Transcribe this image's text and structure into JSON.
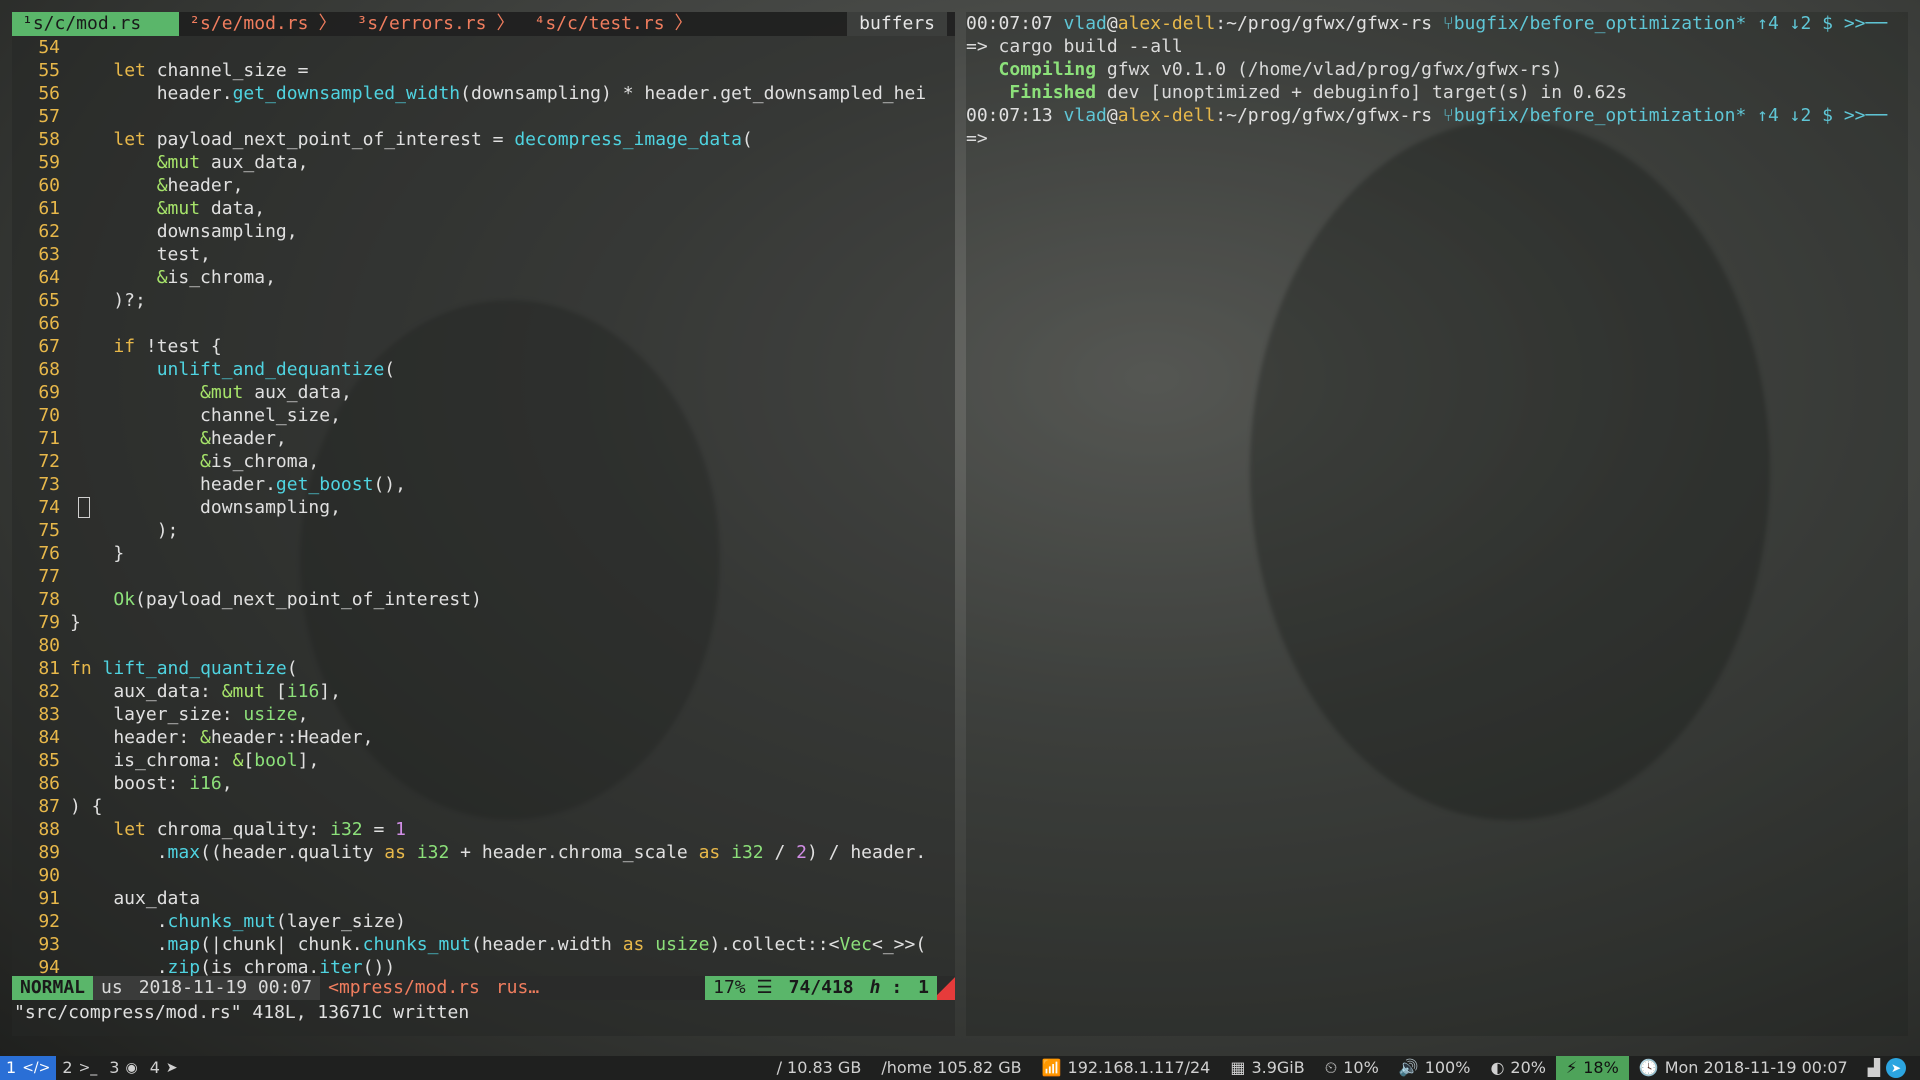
{
  "vim": {
    "tabs": [
      {
        "label": "¹s/c/mod.rs",
        "active": true
      },
      {
        "label": "²s/e/mod.rs",
        "active": false
      },
      {
        "label": "³s/errors.rs",
        "active": false
      },
      {
        "label": "⁴s/c/test.rs",
        "active": false
      }
    ],
    "buffers_label": "buffers",
    "lines": [
      {
        "n": "54",
        "code": ""
      },
      {
        "n": "55",
        "code": "    let channel_size ="
      },
      {
        "n": "56",
        "code": "        header.get_downsampled_width(downsampling) * header.get_downsampled_hei"
      },
      {
        "n": "57",
        "code": ""
      },
      {
        "n": "58",
        "code": "    let payload_next_point_of_interest = decompress_image_data("
      },
      {
        "n": "59",
        "code": "        &mut aux_data,"
      },
      {
        "n": "60",
        "code": "        &header,"
      },
      {
        "n": "61",
        "code": "        &mut data,"
      },
      {
        "n": "62",
        "code": "        downsampling,"
      },
      {
        "n": "63",
        "code": "        test,"
      },
      {
        "n": "64",
        "code": "        &is_chroma,"
      },
      {
        "n": "65",
        "code": "    )?;"
      },
      {
        "n": "66",
        "code": ""
      },
      {
        "n": "67",
        "code": "    if !test {"
      },
      {
        "n": "68",
        "code": "        unlift_and_dequantize("
      },
      {
        "n": "69",
        "code": "            &mut aux_data,"
      },
      {
        "n": "70",
        "code": "            channel_size,"
      },
      {
        "n": "71",
        "code": "            &header,"
      },
      {
        "n": "72",
        "code": "            &is_chroma,"
      },
      {
        "n": "73",
        "code": "            header.get_boost(),"
      },
      {
        "n": "74",
        "code": "            downsampling,"
      },
      {
        "n": "75",
        "code": "        );"
      },
      {
        "n": "76",
        "code": "    }"
      },
      {
        "n": "77",
        "code": ""
      },
      {
        "n": "78",
        "code": "    Ok(payload_next_point_of_interest)"
      },
      {
        "n": "79",
        "code": "}"
      },
      {
        "n": "80",
        "code": ""
      },
      {
        "n": "81",
        "code": "fn lift_and_quantize("
      },
      {
        "n": "82",
        "code": "    aux_data: &mut [i16],"
      },
      {
        "n": "83",
        "code": "    layer_size: usize,"
      },
      {
        "n": "84",
        "code": "    header: &header::Header,"
      },
      {
        "n": "85",
        "code": "    is_chroma: &[bool],"
      },
      {
        "n": "86",
        "code": "    boost: i16,"
      },
      {
        "n": "87",
        "code": ") {"
      },
      {
        "n": "88",
        "code": "    let chroma_quality: i32 = 1"
      },
      {
        "n": "89",
        "code": "        .max((header.quality as i32 + header.chroma_scale as i32 / 2) / header."
      },
      {
        "n": "90",
        "code": ""
      },
      {
        "n": "91",
        "code": "    aux_data"
      },
      {
        "n": "92",
        "code": "        .chunks_mut(layer_size)"
      },
      {
        "n": "93",
        "code": "        .map(|chunk| chunk.chunks_mut(header.width as usize).collect::<Vec<_>>("
      },
      {
        "n": "94",
        "code": "        .zip(is_chroma.iter())"
      }
    ],
    "status": {
      "mode": "NORMAL",
      "keymap": "us",
      "datetime": "2018-11-19 00:07",
      "file": "<mpress/mod.rs",
      "filetype": "rus…",
      "percent": "17% ☰",
      "position": "74/418",
      "column_symbol": "ℎ :",
      "column": "1"
    },
    "cmdline": "\"src/compress/mod.rs\" 418L, 13671C written"
  },
  "terminal": {
    "prompt1": {
      "time": "00:07:07",
      "user": "vlad",
      "host": "alex-dell",
      "path": ":~/prog/gfwx/gfwx-rs",
      "branch": "⑂bugfix/before_optimization* ↑4 ↓2 $ >>──"
    },
    "cmd1": "=> cargo build --all",
    "compile_label": "Compiling",
    "compile_text": " gfwx v0.1.0 (/home/vlad/prog/gfwx/gfwx-rs)",
    "finish_label": "Finished",
    "finish_text": " dev [unoptimized + debuginfo] target(s) in 0.62s",
    "prompt2": {
      "time": "00:07:13",
      "user": "vlad",
      "host": "alex-dell",
      "path": ":~/prog/gfwx/gfwx-rs",
      "branch": "⑂bugfix/before_optimization* ↑4 ↓2 $ >>──"
    },
    "cmd2": "=>"
  },
  "bar": {
    "workspaces": [
      {
        "num": "1",
        "icon": "</>",
        "active": true
      },
      {
        "num": "2",
        "icon": ">_",
        "active": false
      },
      {
        "num": "3",
        "icon": "◉",
        "active": false
      },
      {
        "num": "4",
        "icon": "➤",
        "active": false
      }
    ],
    "disk_root": "/ 10.83 GB",
    "disk_home": "/home 105.82 GB",
    "ip": "192.168.1.117/24",
    "memory": "3.9GiB",
    "cpu": "10%",
    "volume": "100%",
    "brightness": "20%",
    "battery": "18%",
    "clock": "Mon 2018-11-19 00:07"
  }
}
